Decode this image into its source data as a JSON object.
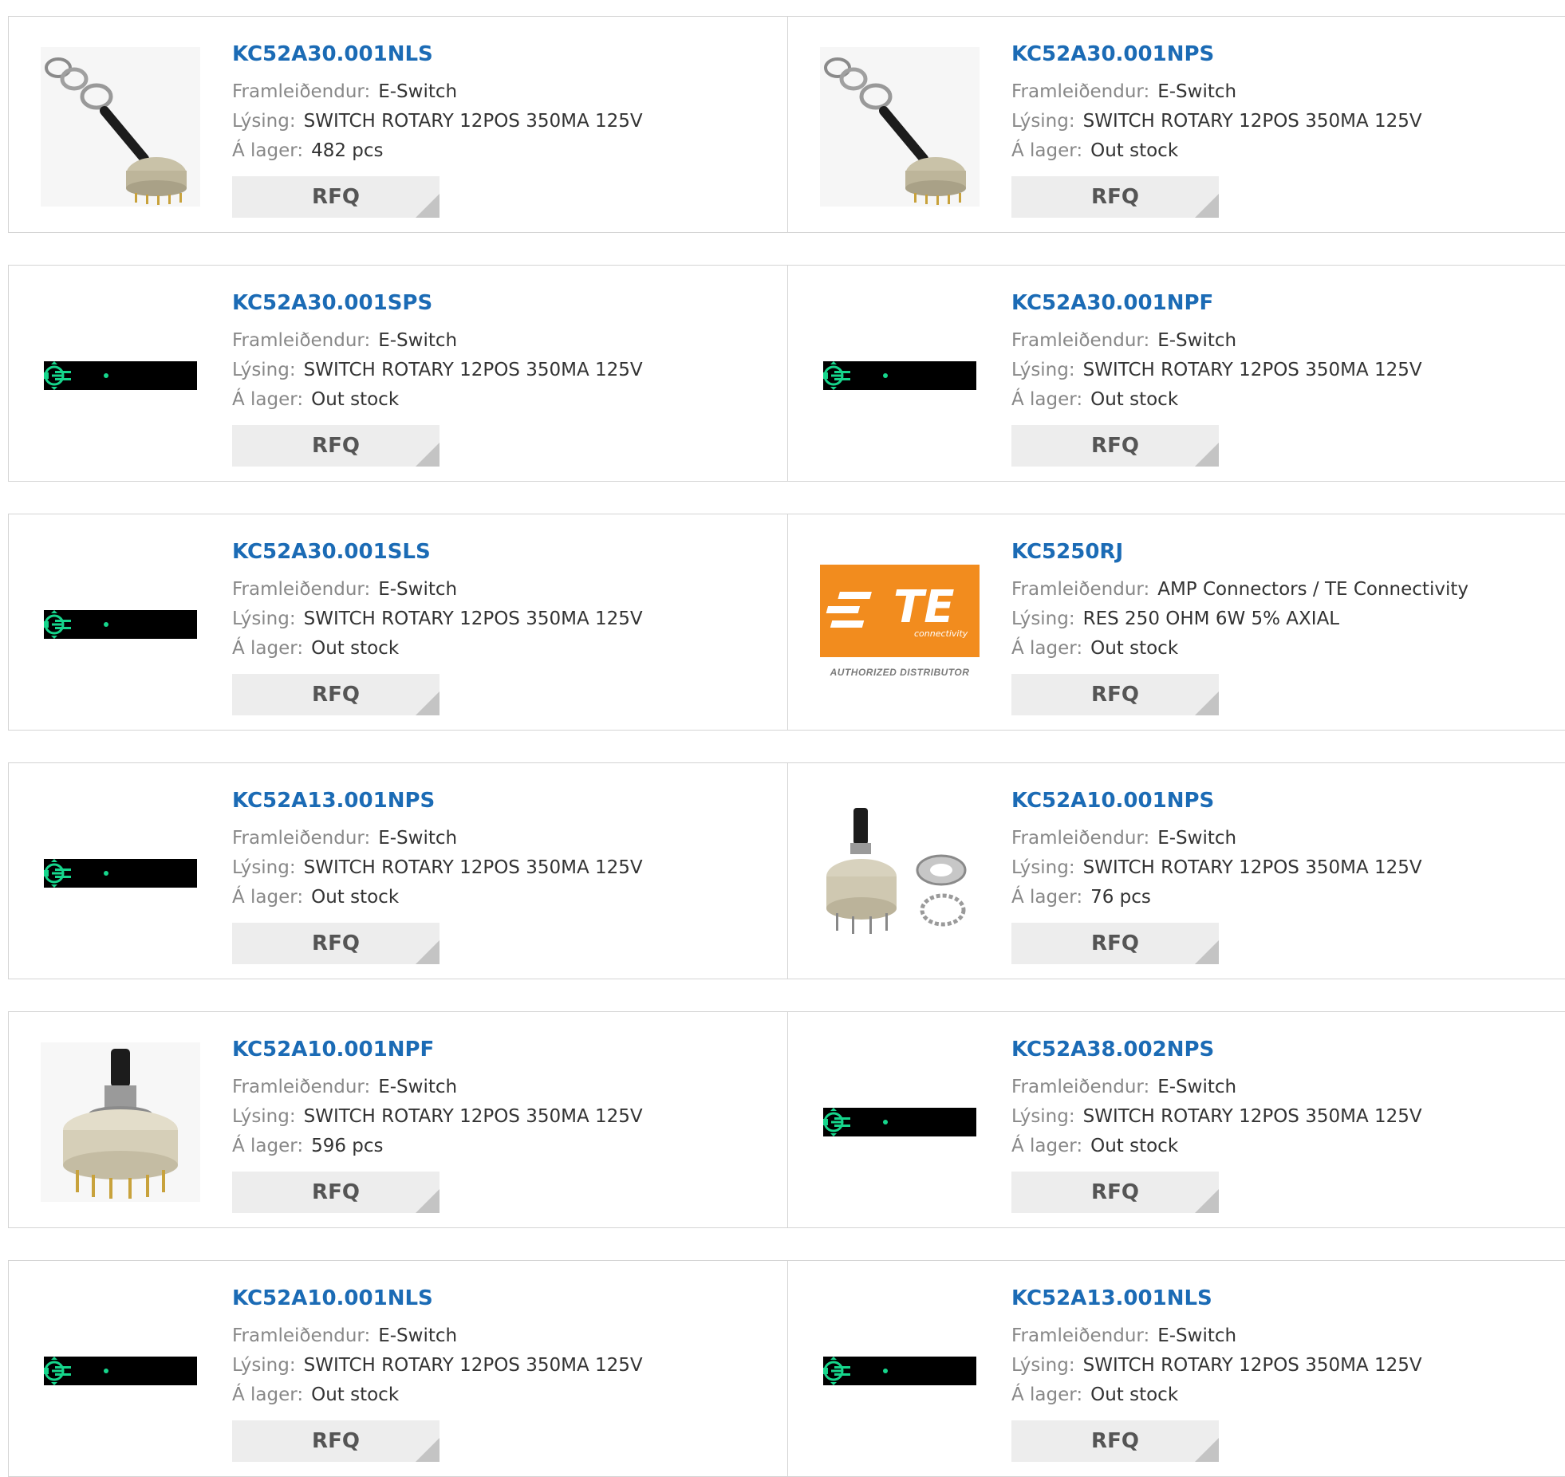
{
  "labels": {
    "manufacturer": "Framleiðendur:",
    "description": "Lýsing:",
    "stock": "Á lager:",
    "rfq": "RFQ"
  },
  "products": [
    {
      "part": "KC52A30.001NLS",
      "manufacturer": "E-Switch",
      "description": "SWITCH ROTARY 12POS 350MA 125V",
      "stock": "482 pcs",
      "image": "rotary-switch-exploded"
    },
    {
      "part": "KC52A30.001NPS",
      "manufacturer": "E-Switch",
      "description": "SWITCH ROTARY 12POS 350MA 125V",
      "stock": "Out stock",
      "image": "rotary-switch-exploded"
    },
    {
      "part": "KC52A30.001SPS",
      "manufacturer": "E-Switch",
      "description": "SWITCH ROTARY 12POS 350MA 125V",
      "stock": "Out stock",
      "image": "placeholder-icon"
    },
    {
      "part": "KC52A30.001NPF",
      "manufacturer": "E-Switch",
      "description": "SWITCH ROTARY 12POS 350MA 125V",
      "stock": "Out stock",
      "image": "placeholder-icon"
    },
    {
      "part": "KC52A30.001SLS",
      "manufacturer": "E-Switch",
      "description": "SWITCH ROTARY 12POS 350MA 125V",
      "stock": "Out stock",
      "image": "placeholder-icon"
    },
    {
      "part": "KC5250RJ",
      "manufacturer": "AMP Connectors / TE Connectivity",
      "description": "RES 250 OHM 6W 5% AXIAL",
      "stock": "Out stock",
      "image": "te-logo",
      "logo_text": "TE",
      "logo_sub": "connectivity",
      "logo_caption": "AUTHORIZED DISTRIBUTOR"
    },
    {
      "part": "KC52A13.001NPS",
      "manufacturer": "E-Switch",
      "description": "SWITCH ROTARY 12POS 350MA 125V",
      "stock": "Out stock",
      "image": "placeholder-icon"
    },
    {
      "part": "KC52A10.001NPS",
      "manufacturer": "E-Switch",
      "description": "SWITCH ROTARY 12POS 350MA 125V",
      "stock": "76 pcs",
      "image": "rotary-switch-with-nut"
    },
    {
      "part": "KC52A10.001NPF",
      "manufacturer": "E-Switch",
      "description": "SWITCH ROTARY 12POS 350MA 125V",
      "stock": "596 pcs",
      "image": "rotary-switch"
    },
    {
      "part": "KC52A38.002NPS",
      "manufacturer": "E-Switch",
      "description": "SWITCH ROTARY 12POS 350MA 125V",
      "stock": "Out stock",
      "image": "placeholder-icon"
    },
    {
      "part": "KC52A10.001NLS",
      "manufacturer": "E-Switch",
      "description": "SWITCH ROTARY 12POS 350MA 125V",
      "stock": "Out stock",
      "image": "placeholder-icon"
    },
    {
      "part": "KC52A13.001NLS",
      "manufacturer": "E-Switch",
      "description": "SWITCH ROTARY 12POS 350MA 125V",
      "stock": "Out stock",
      "image": "placeholder-icon"
    }
  ],
  "colors": {
    "link": "#1b6bb5",
    "label": "#888888",
    "value": "#333333",
    "button_bg": "#ededed",
    "border": "#d4d4d4",
    "te_orange": "#f28c1e",
    "placeholder_green": "#16d68c"
  }
}
